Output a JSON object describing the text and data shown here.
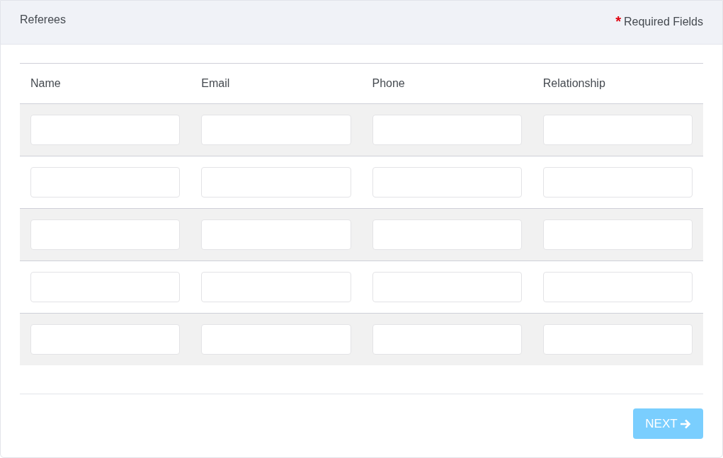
{
  "panel": {
    "title": "Referees",
    "required_marker": "*",
    "required_note": "Required Fields"
  },
  "table": {
    "columns": [
      "Name",
      "Email",
      "Phone",
      "Relationship"
    ],
    "rows": [
      {
        "kind": "inputs"
      },
      {
        "kind": "inputs"
      },
      {
        "kind": "inputs"
      },
      {
        "kind": "inputs"
      },
      {
        "kind": "inputs"
      }
    ]
  },
  "next_button": {
    "label": "NEXT",
    "disabled": true
  }
}
